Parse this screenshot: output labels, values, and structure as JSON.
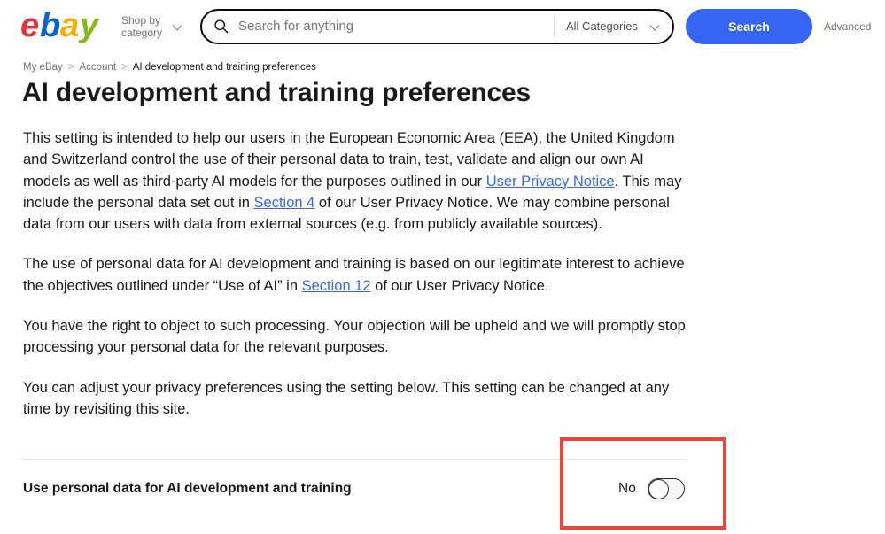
{
  "header": {
    "logo_alt": "ebay",
    "shop_by_category": "Shop by\ncategory",
    "shop_by_category_line1": "Shop by",
    "shop_by_category_line2": "category",
    "search_placeholder": "Search for anything",
    "search_value": "",
    "category_selected": "All Categories",
    "search_button": "Search",
    "advanced_link": "Advanced"
  },
  "breadcrumb": {
    "items": [
      {
        "label": "My eBay"
      },
      {
        "label": "Account"
      },
      {
        "label": "AI development and training preferences"
      }
    ],
    "separator": ">"
  },
  "page": {
    "title": "AI development and training preferences"
  },
  "paragraphs": {
    "p1_a": "This setting is intended to help our users in the European Economic Area (EEA), the United Kingdom and Switzerland control the use of their personal data to train, test, validate and align our own AI models as well as third-party AI models for the purposes outlined in our ",
    "p1_link1": "User Privacy Notice",
    "p1_b": ". This may include the personal data set out in ",
    "p1_link2": "Section 4",
    "p1_c": " of our User Privacy Notice. We may combine personal data from our users with data from external sources (e.g. from publicly available sources).",
    "p2_a": "The use of personal data for AI development and training is based on our legitimate interest to achieve the objectives outlined under “Use of AI” in ",
    "p2_link1": "Section 12",
    "p2_b": " of our User Privacy Notice.",
    "p3": "You have the right to object to such processing. Your objection will be upheld and we will promptly stop processing your personal data for the relevant purposes.",
    "p4": "You can adjust your privacy preferences using the setting below. This setting can be changed at any time by revisiting this site."
  },
  "setting": {
    "label": "Use personal data for AI development and training",
    "toggle_value": "No",
    "toggle_on": false
  },
  "colors": {
    "accent_blue": "#3665f3",
    "link_blue": "#3665f3",
    "highlight_red": "#e8453c",
    "logo_red": "#e53238",
    "logo_blue": "#0064d2",
    "logo_yellow": "#f5af02",
    "logo_green": "#86b817",
    "text": "#191919",
    "muted_text": "#707070"
  }
}
